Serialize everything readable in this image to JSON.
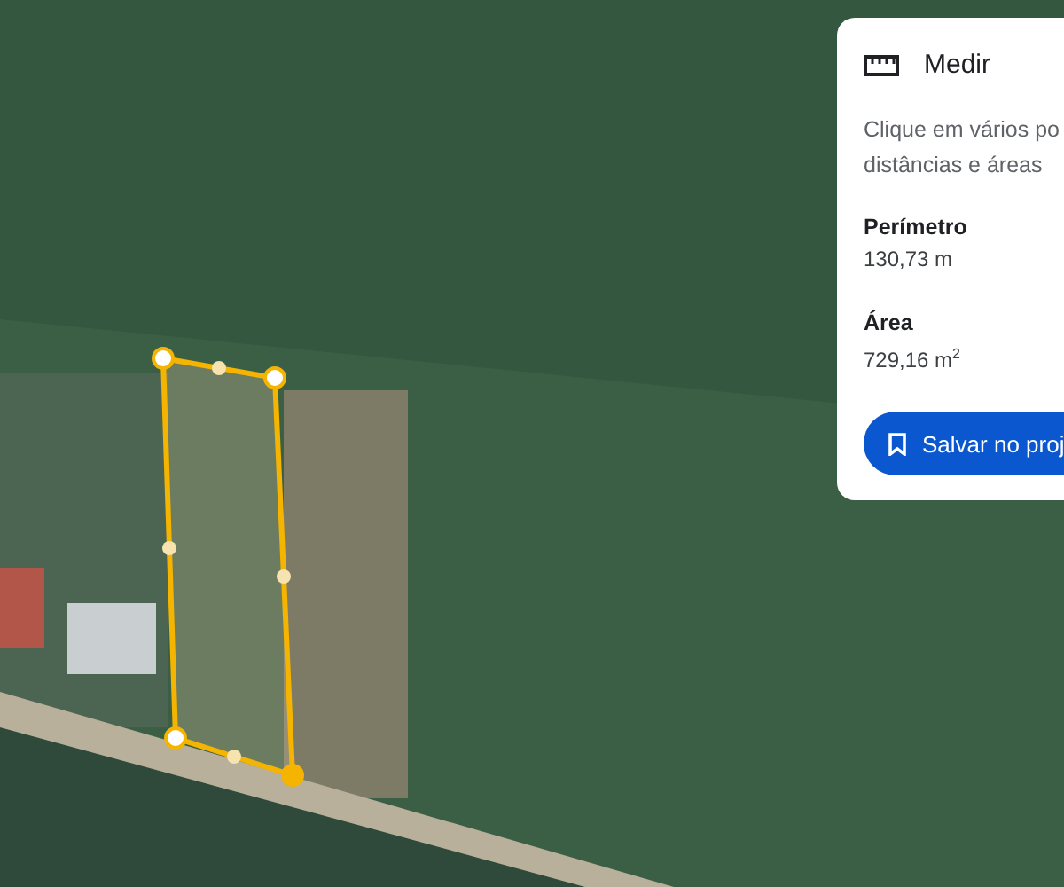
{
  "panel": {
    "title": "Medir",
    "hint": "Clique em vários po\ndistâncias e áreas",
    "measurements": [
      {
        "label": "Perímetro",
        "value": "130,73 m"
      },
      {
        "label": "Área",
        "value": "729,16 m$^{2}$"
      }
    ],
    "save_button": "Salvar no proj"
  }
}
